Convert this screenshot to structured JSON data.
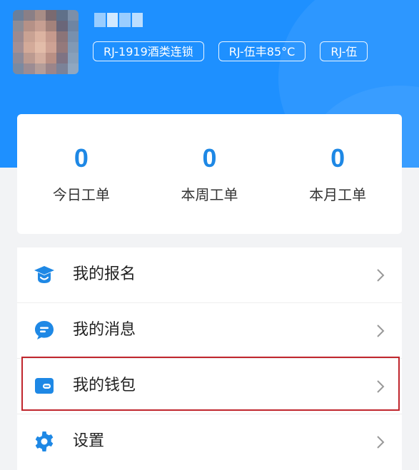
{
  "header": {
    "tags": [
      "RJ-1919酒类连锁",
      "RJ-伍丰85°C",
      "RJ-伍"
    ]
  },
  "stats": [
    {
      "value": "0",
      "label": "今日工单"
    },
    {
      "value": "0",
      "label": "本周工单"
    },
    {
      "value": "0",
      "label": "本月工单"
    }
  ],
  "menu": [
    {
      "label": "我的报名",
      "icon": "graduation-cap-icon"
    },
    {
      "label": "我的消息",
      "icon": "chat-bubble-icon"
    },
    {
      "label": "我的钱包",
      "icon": "wallet-icon"
    },
    {
      "label": "设置",
      "icon": "gear-icon"
    }
  ],
  "colors": {
    "header_bg": "#1e90ff",
    "accent": "#1e88e5",
    "highlight_border": "#c0262d"
  }
}
